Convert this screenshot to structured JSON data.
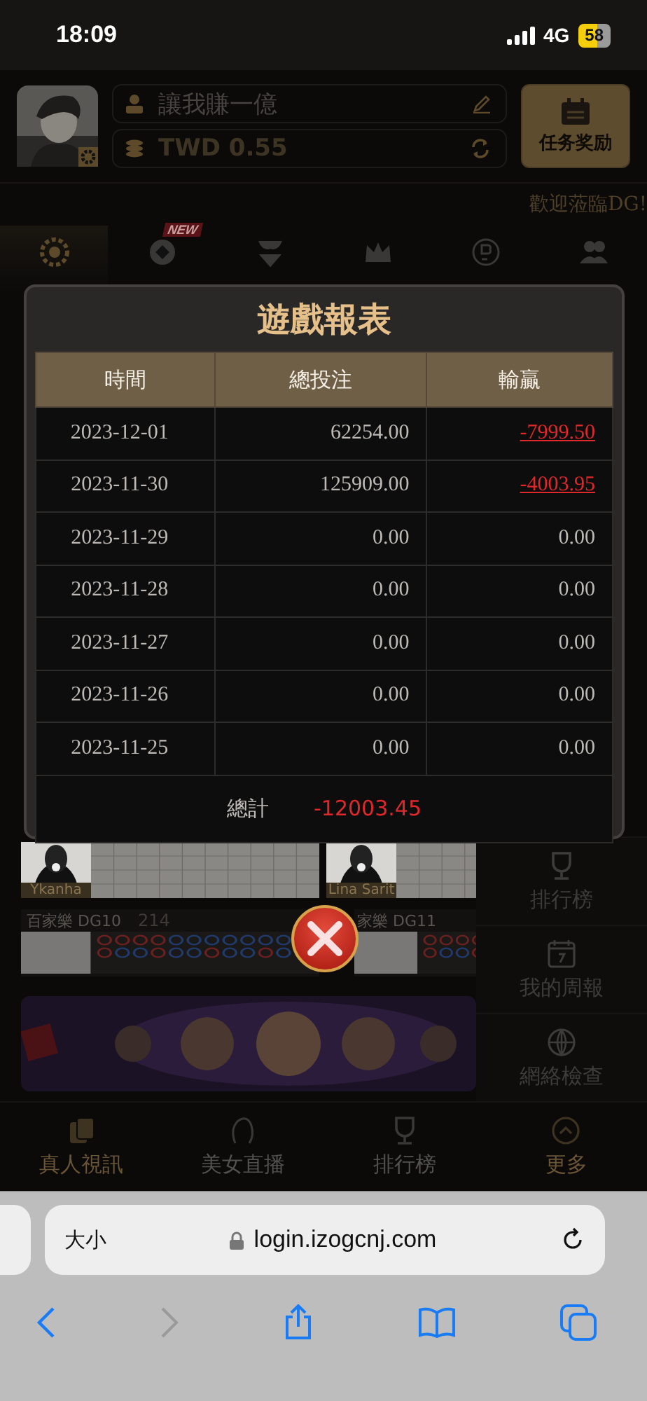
{
  "status_bar": {
    "time": "18:09",
    "network": "4G",
    "battery": "58"
  },
  "header": {
    "username": "讓我賺一億",
    "balance": "TWD 0.55",
    "task_button": "任务奖励"
  },
  "marquee": "歡迎蒞臨DG!",
  "category_tabs": [
    {
      "selected": true
    },
    {
      "selected": false,
      "badge": "NEW"
    },
    {
      "selected": false
    },
    {
      "selected": false
    },
    {
      "selected": false
    },
    {
      "selected": false
    }
  ],
  "game_cards": [
    {
      "dealer": "Ykanha"
    },
    {
      "dealer": "Lina Sarit"
    }
  ],
  "game_tables": [
    {
      "name": "百家樂 DG10",
      "players": "214"
    },
    {
      "name": "家樂 DG11"
    }
  ],
  "side_menu": [
    {
      "label": "排行榜"
    },
    {
      "label": "我的周報"
    },
    {
      "label": "網絡檢查"
    }
  ],
  "bottom_nav": [
    {
      "label": "真人視訊"
    },
    {
      "label": "美女直播"
    },
    {
      "label": "排行榜"
    },
    {
      "label": "更多"
    }
  ],
  "report": {
    "title": "遊戲報表",
    "columns": [
      "時間",
      "總投注",
      "輸贏"
    ],
    "rows": [
      {
        "date": "2023-12-01",
        "bet": "62254.00",
        "result": "-7999.50",
        "link": true
      },
      {
        "date": "2023-11-30",
        "bet": "125909.00",
        "result": "-4003.95",
        "link": true
      },
      {
        "date": "2023-11-29",
        "bet": "0.00",
        "result": "0.00",
        "link": false
      },
      {
        "date": "2023-11-28",
        "bet": "0.00",
        "result": "0.00",
        "link": false
      },
      {
        "date": "2023-11-27",
        "bet": "0.00",
        "result": "0.00",
        "link": false
      },
      {
        "date": "2023-11-26",
        "bet": "0.00",
        "result": "0.00",
        "link": false
      },
      {
        "date": "2023-11-25",
        "bet": "0.00",
        "result": "0.00",
        "link": false
      }
    ],
    "total_label": "總計",
    "total_value": "-12003.45"
  },
  "browser": {
    "text_size": "大小",
    "url": "login.izogcnj.com"
  }
}
